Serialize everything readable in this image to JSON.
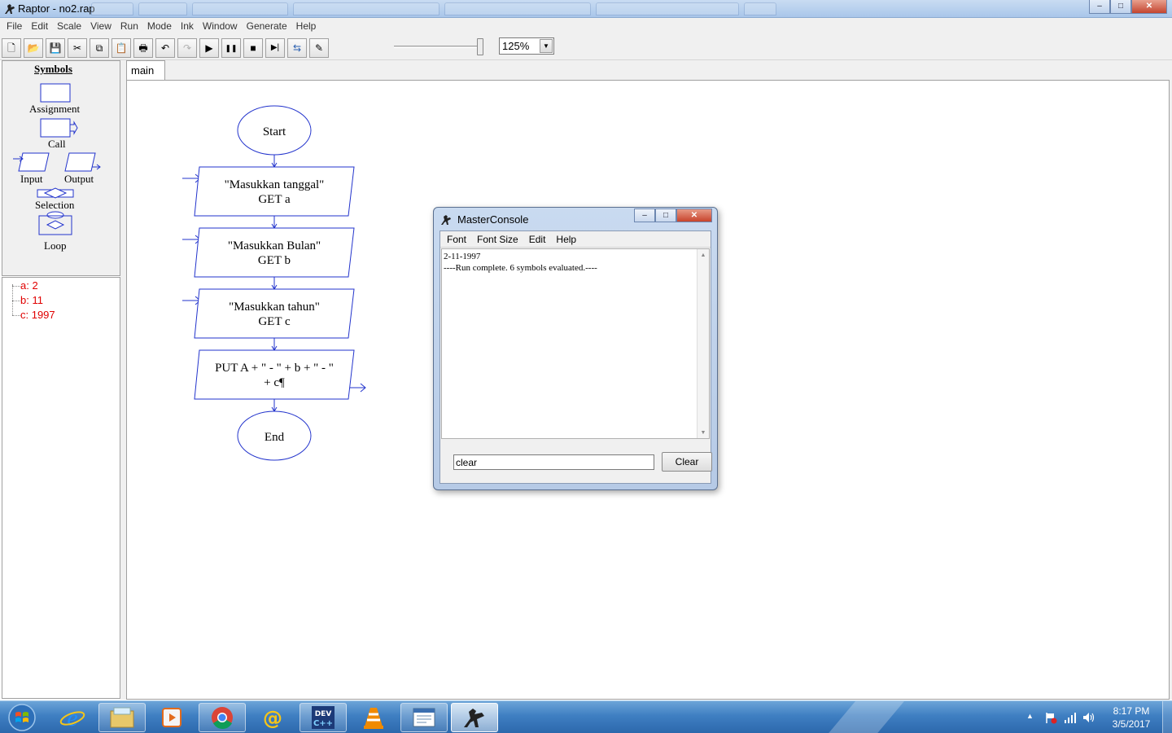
{
  "window": {
    "title": "Raptor - no2.rap",
    "minimize_glyph": "–",
    "maximize_glyph": "□",
    "close_glyph": "✕"
  },
  "menubar": [
    "File",
    "Edit",
    "Scale",
    "View",
    "Run",
    "Mode",
    "Ink",
    "Window",
    "Generate",
    "Help"
  ],
  "toolbar": {
    "buttons": [
      {
        "name": "new-icon",
        "glyph": "🗋"
      },
      {
        "name": "open-icon",
        "glyph": "📂"
      },
      {
        "name": "save-icon",
        "glyph": "💾"
      },
      {
        "name": "cut-icon",
        "glyph": "✂"
      },
      {
        "name": "copy-icon",
        "glyph": "⧉"
      },
      {
        "name": "paste-icon",
        "glyph": "📋"
      },
      {
        "name": "print-icon",
        "glyph": "🖶"
      },
      {
        "name": "undo-icon",
        "glyph": "↶"
      },
      {
        "name": "redo-icon",
        "glyph": "↷"
      },
      {
        "name": "run-icon",
        "glyph": "▶"
      },
      {
        "name": "pause-icon",
        "glyph": "❚❚"
      },
      {
        "name": "stop-icon",
        "glyph": "■"
      },
      {
        "name": "step-icon",
        "glyph": "▶|"
      },
      {
        "name": "test-server-icon",
        "glyph": "⇆"
      },
      {
        "name": "pen-icon",
        "glyph": "✎"
      }
    ],
    "speed_level": 1.0,
    "zoom": "125%"
  },
  "symbols": {
    "heading": "Symbols",
    "items": [
      "Assignment",
      "Call",
      "Input",
      "Output",
      "Selection",
      "Loop"
    ]
  },
  "variables": [
    "a: 2",
    "b: 11",
    "c: 1997"
  ],
  "tabs": [
    "main"
  ],
  "flowchart": {
    "start": "Start",
    "input1_line1": "\"Masukkan tanggal\"",
    "input1_line2": "GET a",
    "input2_line1": "\"Masukkan Bulan\"",
    "input2_line2": "GET b",
    "input3_line1": "\"Masukkan tahun\"",
    "input3_line2": "GET c",
    "output_line1": "PUT A + \" - \" + b + \" - \"",
    "output_line2": "+ c¶",
    "end": "End"
  },
  "console": {
    "title": "MasterConsole",
    "menu": [
      "Font",
      "Font Size",
      "Edit",
      "Help"
    ],
    "output": [
      "2-11-1997",
      "----Run complete.  6 symbols evaluated.----"
    ],
    "input_value": "clear",
    "clear_label": "Clear"
  },
  "taskbar": {
    "apps": [
      "start-orb",
      "internet-explorer",
      "file-explorer",
      "media-player",
      "chrome",
      "mail-client",
      "dev-cpp",
      "vlc",
      "notepad-window",
      "raptor"
    ],
    "tray_arrow": "▲",
    "time": "8:17 PM",
    "date": "3/5/2017"
  }
}
